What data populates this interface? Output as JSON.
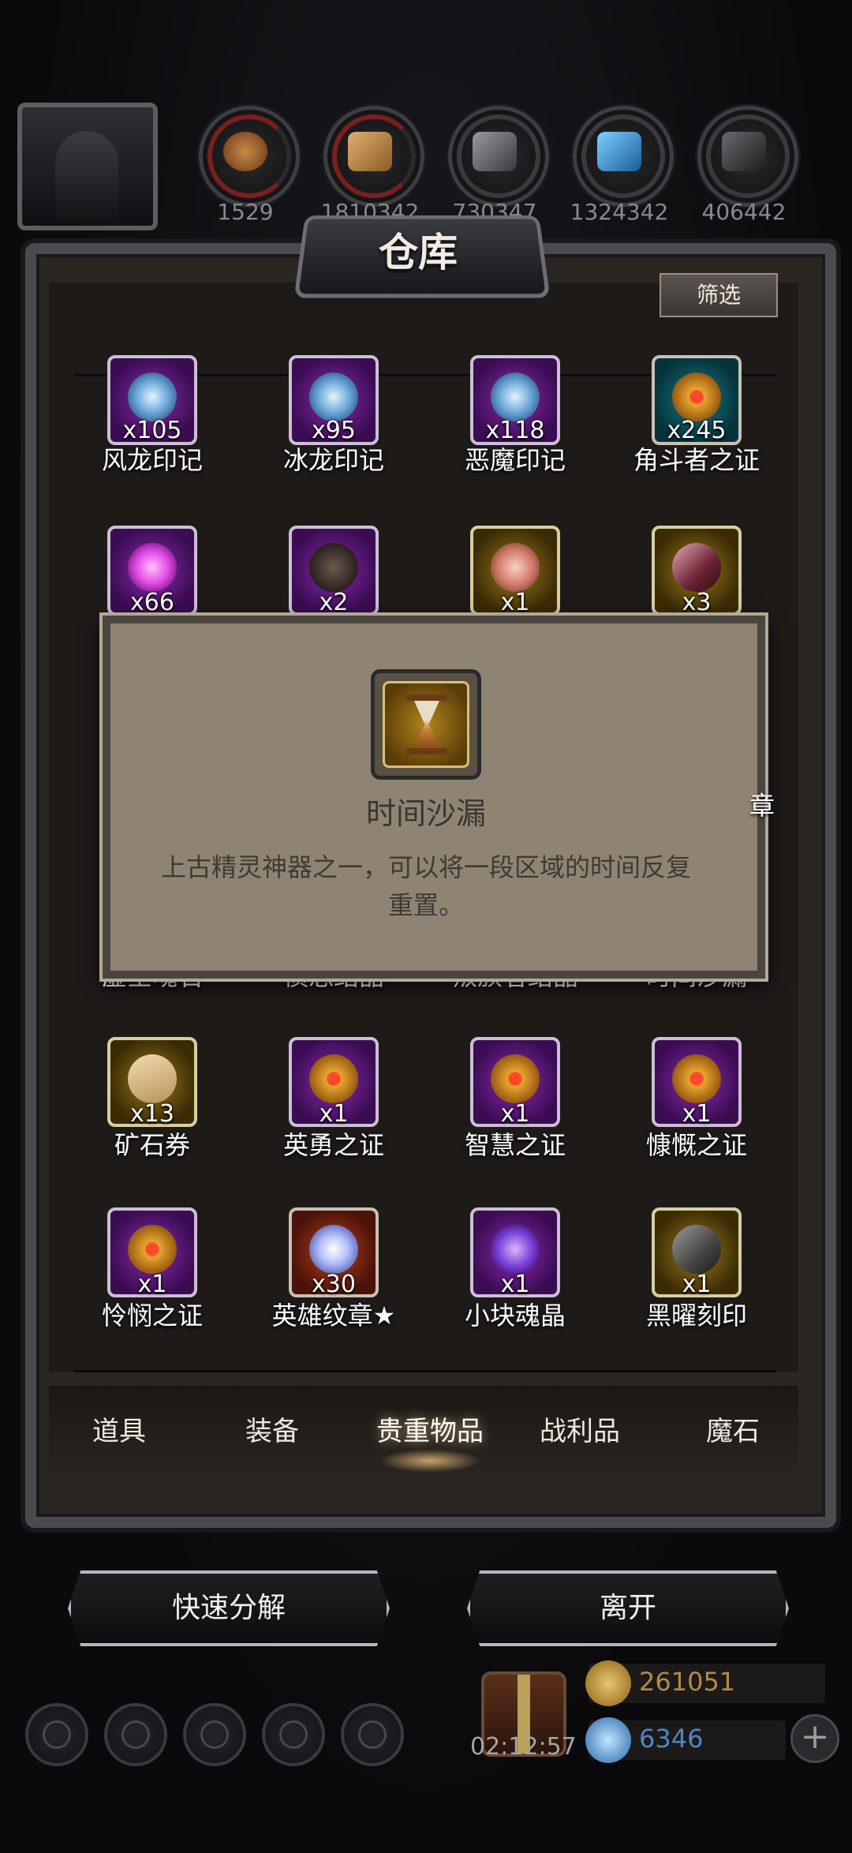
{
  "resources": [
    {
      "icon": "wood-log-icon",
      "value": "1529"
    },
    {
      "icon": "plank-icon",
      "value": "1810342"
    },
    {
      "icon": "iron-bar-icon",
      "value": "730347"
    },
    {
      "icon": "blue-crystal-icon",
      "value": "1324342"
    },
    {
      "icon": "dark-ingot-icon",
      "value": "406442"
    }
  ],
  "panel": {
    "title": "仓库",
    "filter_label": "筛选"
  },
  "items": [
    {
      "name": "风龙印记",
      "count": "x105",
      "rarity": "purple",
      "icon": "wind-dragon-mark-icon"
    },
    {
      "name": "冰龙印记",
      "count": "x95",
      "rarity": "purple",
      "icon": "ice-dragon-mark-icon"
    },
    {
      "name": "恶魔印记",
      "count": "x118",
      "rarity": "purple",
      "icon": "demon-mark-icon"
    },
    {
      "name": "角斗者之证",
      "count": "x245",
      "rarity": "teal",
      "icon": "gladiator-proof-icon"
    },
    {
      "name": "",
      "count": "x66",
      "rarity": "purple",
      "icon": "void-soul-stone-icon"
    },
    {
      "name": "",
      "count": "x2",
      "rarity": "purple",
      "icon": "wrath-crystal-icon"
    },
    {
      "name": "",
      "count": "x1",
      "rarity": "gold",
      "icon": "betrayer-crystal-icon"
    },
    {
      "name": "",
      "count": "x3",
      "rarity": "gold",
      "icon": "time-hourglass-icon"
    },
    {
      "name": "矿石券",
      "count": "x13",
      "rarity": "gold",
      "icon": "ore-voucher-icon"
    },
    {
      "name": "英勇之证",
      "count": "x1",
      "rarity": "purple",
      "icon": "valor-proof-icon"
    },
    {
      "name": "智慧之证",
      "count": "x1",
      "rarity": "purple",
      "icon": "wisdom-proof-icon"
    },
    {
      "name": "慷慨之证",
      "count": "x1",
      "rarity": "purple",
      "icon": "generosity-proof-icon"
    },
    {
      "name": "怜悯之证",
      "count": "x1",
      "rarity": "purple",
      "icon": "mercy-proof-icon"
    },
    {
      "name": "英雄纹章★",
      "count": "x30",
      "rarity": "red",
      "icon": "hero-crest-icon"
    },
    {
      "name": "小块魂晶",
      "count": "x1",
      "rarity": "purple",
      "icon": "soul-crystal-shard-icon"
    },
    {
      "name": "黑曜刻印",
      "count": "x1",
      "rarity": "gold",
      "icon": "obsidian-seal-icon"
    }
  ],
  "partial_labels": {
    "row2_col1": "虚空魂石",
    "row2_col2": "愤怒结晶",
    "row2_col3": "叛族者结晶",
    "row2_col4": "时间沙漏",
    "right_edge": "章"
  },
  "tooltip": {
    "name": "时间沙漏",
    "description": "上古精灵神器之一，可以将一段区域的时间反复重置。",
    "icon": "hourglass-icon"
  },
  "tabs": [
    {
      "label": "道具",
      "active": false
    },
    {
      "label": "装备",
      "active": false
    },
    {
      "label": "贵重物品",
      "active": true
    },
    {
      "label": "战利品",
      "active": false
    },
    {
      "label": "魔石",
      "active": false
    }
  ],
  "actions": {
    "quick_disassemble": "快速分解",
    "leave": "离开"
  },
  "bottom": {
    "timer": "02:12:57",
    "gold": "261051",
    "gems": "6346",
    "gold_color": "#b38a4a",
    "gem_color": "#4f86c2"
  }
}
